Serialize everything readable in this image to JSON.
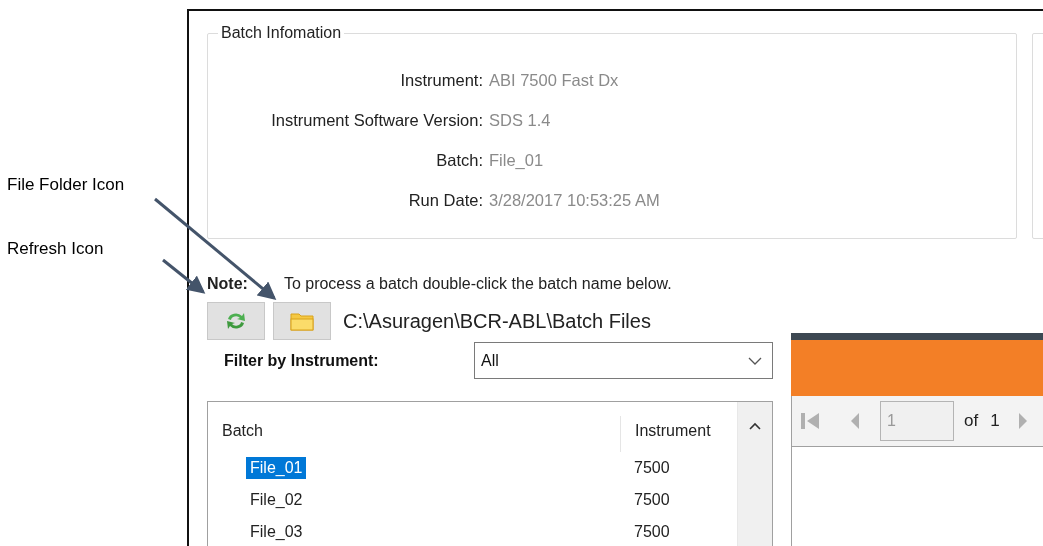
{
  "annotations": [
    {
      "text": "File Folder Icon"
    },
    {
      "text": "Refresh Icon"
    }
  ],
  "batch_information": {
    "title": "Batch Infomation",
    "fields": [
      {
        "label": "Instrument:",
        "value": "ABI 7500 Fast Dx"
      },
      {
        "label": "Instrument Software Version:",
        "value": "SDS 1.4"
      },
      {
        "label": "Batch:",
        "value": "File_01"
      },
      {
        "label": "Run Date:",
        "value": "3/28/2017 10:53:25 AM"
      }
    ]
  },
  "note": {
    "label": "Note:",
    "text": "To process a batch double-click the batch name below."
  },
  "path": "C:\\Asuragen\\BCR-ABL\\Batch Files",
  "filter": {
    "label": "Filter by Instrument:",
    "value": "All"
  },
  "batch_list": {
    "columns": [
      "Batch",
      "Instrument"
    ],
    "rows": [
      {
        "batch": "File_01",
        "instrument": "7500",
        "selected": true
      },
      {
        "batch": "File_02",
        "instrument": "7500",
        "selected": false
      },
      {
        "batch": "File_03",
        "instrument": "7500",
        "selected": false
      }
    ]
  },
  "pager": {
    "page": "1",
    "of_label": "of",
    "total": "1"
  }
}
